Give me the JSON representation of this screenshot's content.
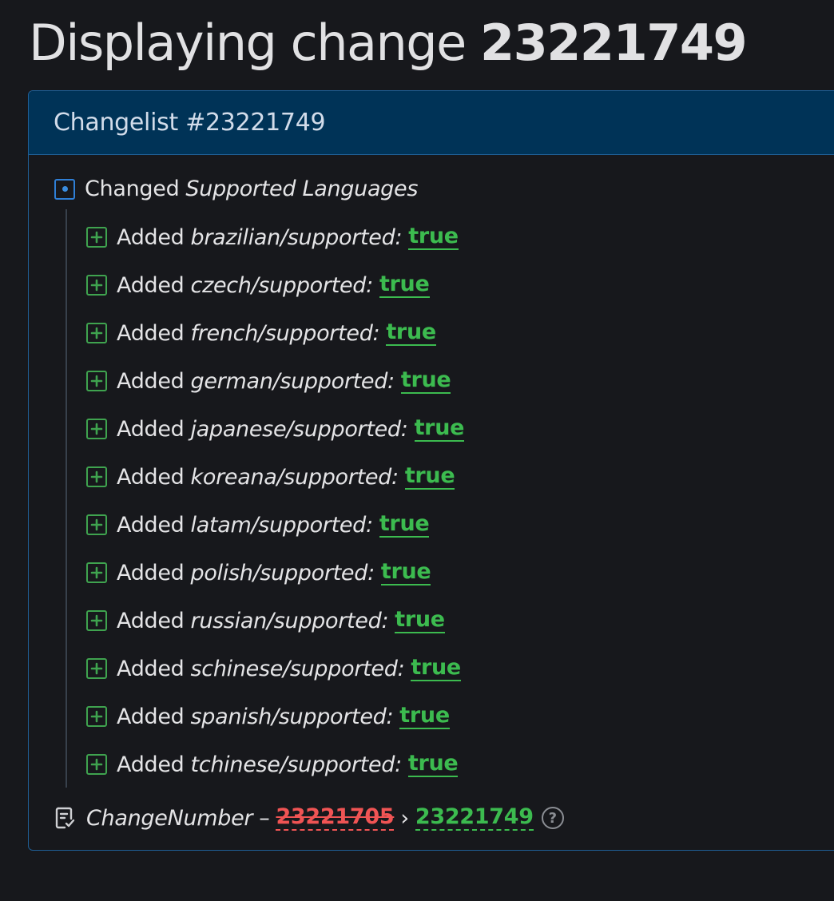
{
  "page": {
    "title_prefix": "Displaying change",
    "title_number": "23221749"
  },
  "panel": {
    "header": "Changelist #23221749",
    "group": {
      "verb": "Changed",
      "name": "Supported Languages",
      "icon": "changed-square-icon"
    },
    "items": [
      {
        "verb": "Added",
        "key": "brazilian/supported:",
        "value": "true"
      },
      {
        "verb": "Added",
        "key": "czech/supported:",
        "value": "true"
      },
      {
        "verb": "Added",
        "key": "french/supported:",
        "value": "true"
      },
      {
        "verb": "Added",
        "key": "german/supported:",
        "value": "true"
      },
      {
        "verb": "Added",
        "key": "japanese/supported:",
        "value": "true"
      },
      {
        "verb": "Added",
        "key": "koreana/supported:",
        "value": "true"
      },
      {
        "verb": "Added",
        "key": "latam/supported:",
        "value": "true"
      },
      {
        "verb": "Added",
        "key": "polish/supported:",
        "value": "true"
      },
      {
        "verb": "Added",
        "key": "russian/supported:",
        "value": "true"
      },
      {
        "verb": "Added",
        "key": "schinese/supported:",
        "value": "true"
      },
      {
        "verb": "Added",
        "key": "spanish/supported:",
        "value": "true"
      },
      {
        "verb": "Added",
        "key": "tchinese/supported:",
        "value": "true"
      }
    ],
    "change_number": {
      "label": "ChangeNumber",
      "dash": "–",
      "old": "23221705",
      "arrow": "›",
      "new": "23221749",
      "help": "?"
    }
  },
  "colors": {
    "added": "#3cbb4f",
    "removed": "#f05454",
    "header_bg": "#003357",
    "accent": "#2f7fd6"
  }
}
